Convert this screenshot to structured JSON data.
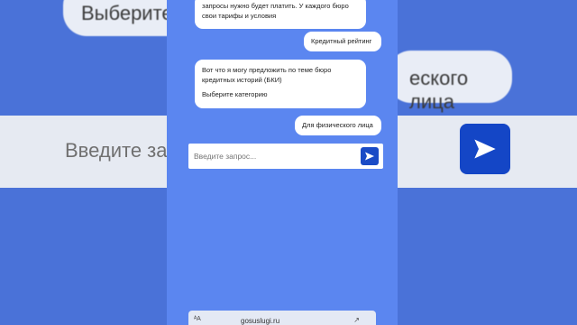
{
  "background": {
    "top_bubble": "Выберите к",
    "right_bubble": "еского лица",
    "input_placeholder": "Введите зап"
  },
  "chat": {
    "messages": [
      {
        "from": "bot",
        "lines": [
          "запросы нужно будет платить. У каждого бюро",
          "свои тарифы и условия"
        ]
      },
      {
        "from": "user",
        "text": "Кредитный рейтинг"
      },
      {
        "from": "bot",
        "lines": [
          "Вот что я могу предложить по теме бюро",
          "кредитных историй (БКИ)",
          "",
          "Выберите категорию"
        ]
      },
      {
        "from": "user",
        "text": "Для физического лица"
      }
    ]
  },
  "input": {
    "placeholder": "Введите запрос..."
  },
  "browser": {
    "url": "gosuslugi.ru"
  },
  "colors": {
    "accent": "#1a4bc6",
    "background": "#5b86f0"
  }
}
